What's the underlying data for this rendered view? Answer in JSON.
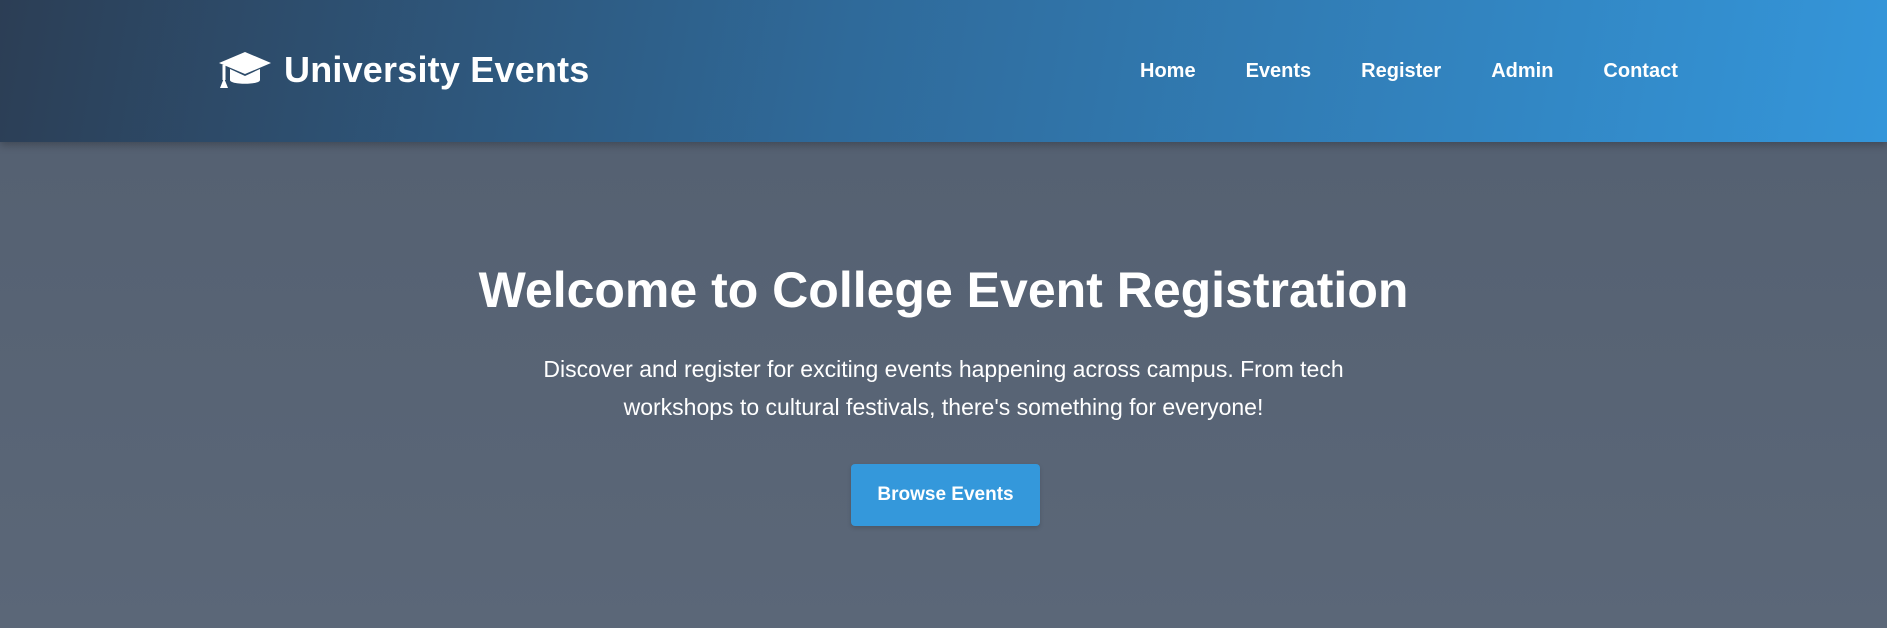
{
  "header": {
    "brand": {
      "icon": "graduation-cap-icon",
      "title": "University Events"
    },
    "nav": [
      {
        "label": "Home"
      },
      {
        "label": "Events"
      },
      {
        "label": "Register"
      },
      {
        "label": "Admin"
      },
      {
        "label": "Contact"
      }
    ]
  },
  "hero": {
    "title": "Welcome to College Event Registration",
    "subtitle": "Discover and register for exciting events happening across campus. From tech workshops to cultural festivals, there's something for everyone!",
    "cta_label": "Browse Events"
  },
  "colors": {
    "header_gradient_start": "#2c3e55",
    "header_gradient_end": "#3496da",
    "hero_background": "#566273",
    "accent": "#3498db",
    "text": "#ffffff"
  }
}
